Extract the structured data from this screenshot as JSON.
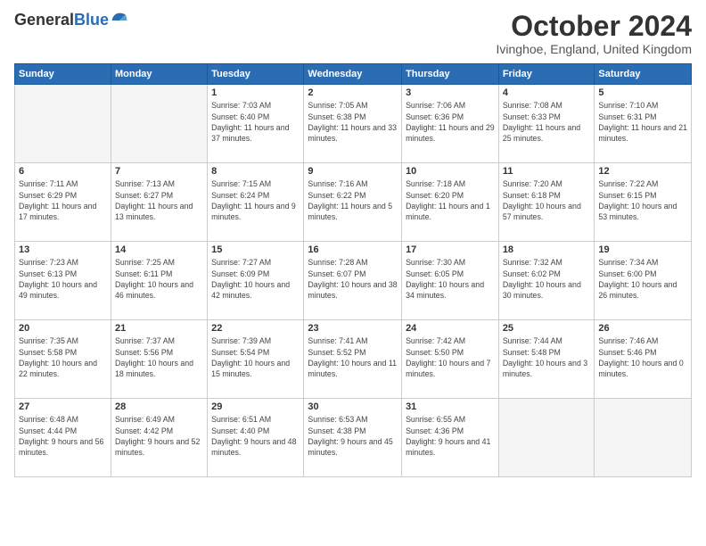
{
  "header": {
    "logo_general": "General",
    "logo_blue": "Blue",
    "month_title": "October 2024",
    "location": "Ivinghoe, England, United Kingdom"
  },
  "days_of_week": [
    "Sunday",
    "Monday",
    "Tuesday",
    "Wednesday",
    "Thursday",
    "Friday",
    "Saturday"
  ],
  "weeks": [
    [
      {
        "day": "",
        "sunrise": "",
        "sunset": "",
        "daylight": ""
      },
      {
        "day": "",
        "sunrise": "",
        "sunset": "",
        "daylight": ""
      },
      {
        "day": "1",
        "sunrise": "Sunrise: 7:03 AM",
        "sunset": "Sunset: 6:40 PM",
        "daylight": "Daylight: 11 hours and 37 minutes."
      },
      {
        "day": "2",
        "sunrise": "Sunrise: 7:05 AM",
        "sunset": "Sunset: 6:38 PM",
        "daylight": "Daylight: 11 hours and 33 minutes."
      },
      {
        "day": "3",
        "sunrise": "Sunrise: 7:06 AM",
        "sunset": "Sunset: 6:36 PM",
        "daylight": "Daylight: 11 hours and 29 minutes."
      },
      {
        "day": "4",
        "sunrise": "Sunrise: 7:08 AM",
        "sunset": "Sunset: 6:33 PM",
        "daylight": "Daylight: 11 hours and 25 minutes."
      },
      {
        "day": "5",
        "sunrise": "Sunrise: 7:10 AM",
        "sunset": "Sunset: 6:31 PM",
        "daylight": "Daylight: 11 hours and 21 minutes."
      }
    ],
    [
      {
        "day": "6",
        "sunrise": "Sunrise: 7:11 AM",
        "sunset": "Sunset: 6:29 PM",
        "daylight": "Daylight: 11 hours and 17 minutes."
      },
      {
        "day": "7",
        "sunrise": "Sunrise: 7:13 AM",
        "sunset": "Sunset: 6:27 PM",
        "daylight": "Daylight: 11 hours and 13 minutes."
      },
      {
        "day": "8",
        "sunrise": "Sunrise: 7:15 AM",
        "sunset": "Sunset: 6:24 PM",
        "daylight": "Daylight: 11 hours and 9 minutes."
      },
      {
        "day": "9",
        "sunrise": "Sunrise: 7:16 AM",
        "sunset": "Sunset: 6:22 PM",
        "daylight": "Daylight: 11 hours and 5 minutes."
      },
      {
        "day": "10",
        "sunrise": "Sunrise: 7:18 AM",
        "sunset": "Sunset: 6:20 PM",
        "daylight": "Daylight: 11 hours and 1 minute."
      },
      {
        "day": "11",
        "sunrise": "Sunrise: 7:20 AM",
        "sunset": "Sunset: 6:18 PM",
        "daylight": "Daylight: 10 hours and 57 minutes."
      },
      {
        "day": "12",
        "sunrise": "Sunrise: 7:22 AM",
        "sunset": "Sunset: 6:15 PM",
        "daylight": "Daylight: 10 hours and 53 minutes."
      }
    ],
    [
      {
        "day": "13",
        "sunrise": "Sunrise: 7:23 AM",
        "sunset": "Sunset: 6:13 PM",
        "daylight": "Daylight: 10 hours and 49 minutes."
      },
      {
        "day": "14",
        "sunrise": "Sunrise: 7:25 AM",
        "sunset": "Sunset: 6:11 PM",
        "daylight": "Daylight: 10 hours and 46 minutes."
      },
      {
        "day": "15",
        "sunrise": "Sunrise: 7:27 AM",
        "sunset": "Sunset: 6:09 PM",
        "daylight": "Daylight: 10 hours and 42 minutes."
      },
      {
        "day": "16",
        "sunrise": "Sunrise: 7:28 AM",
        "sunset": "Sunset: 6:07 PM",
        "daylight": "Daylight: 10 hours and 38 minutes."
      },
      {
        "day": "17",
        "sunrise": "Sunrise: 7:30 AM",
        "sunset": "Sunset: 6:05 PM",
        "daylight": "Daylight: 10 hours and 34 minutes."
      },
      {
        "day": "18",
        "sunrise": "Sunrise: 7:32 AM",
        "sunset": "Sunset: 6:02 PM",
        "daylight": "Daylight: 10 hours and 30 minutes."
      },
      {
        "day": "19",
        "sunrise": "Sunrise: 7:34 AM",
        "sunset": "Sunset: 6:00 PM",
        "daylight": "Daylight: 10 hours and 26 minutes."
      }
    ],
    [
      {
        "day": "20",
        "sunrise": "Sunrise: 7:35 AM",
        "sunset": "Sunset: 5:58 PM",
        "daylight": "Daylight: 10 hours and 22 minutes."
      },
      {
        "day": "21",
        "sunrise": "Sunrise: 7:37 AM",
        "sunset": "Sunset: 5:56 PM",
        "daylight": "Daylight: 10 hours and 18 minutes."
      },
      {
        "day": "22",
        "sunrise": "Sunrise: 7:39 AM",
        "sunset": "Sunset: 5:54 PM",
        "daylight": "Daylight: 10 hours and 15 minutes."
      },
      {
        "day": "23",
        "sunrise": "Sunrise: 7:41 AM",
        "sunset": "Sunset: 5:52 PM",
        "daylight": "Daylight: 10 hours and 11 minutes."
      },
      {
        "day": "24",
        "sunrise": "Sunrise: 7:42 AM",
        "sunset": "Sunset: 5:50 PM",
        "daylight": "Daylight: 10 hours and 7 minutes."
      },
      {
        "day": "25",
        "sunrise": "Sunrise: 7:44 AM",
        "sunset": "Sunset: 5:48 PM",
        "daylight": "Daylight: 10 hours and 3 minutes."
      },
      {
        "day": "26",
        "sunrise": "Sunrise: 7:46 AM",
        "sunset": "Sunset: 5:46 PM",
        "daylight": "Daylight: 10 hours and 0 minutes."
      }
    ],
    [
      {
        "day": "27",
        "sunrise": "Sunrise: 6:48 AM",
        "sunset": "Sunset: 4:44 PM",
        "daylight": "Daylight: 9 hours and 56 minutes."
      },
      {
        "day": "28",
        "sunrise": "Sunrise: 6:49 AM",
        "sunset": "Sunset: 4:42 PM",
        "daylight": "Daylight: 9 hours and 52 minutes."
      },
      {
        "day": "29",
        "sunrise": "Sunrise: 6:51 AM",
        "sunset": "Sunset: 4:40 PM",
        "daylight": "Daylight: 9 hours and 48 minutes."
      },
      {
        "day": "30",
        "sunrise": "Sunrise: 6:53 AM",
        "sunset": "Sunset: 4:38 PM",
        "daylight": "Daylight: 9 hours and 45 minutes."
      },
      {
        "day": "31",
        "sunrise": "Sunrise: 6:55 AM",
        "sunset": "Sunset: 4:36 PM",
        "daylight": "Daylight: 9 hours and 41 minutes."
      },
      {
        "day": "",
        "sunrise": "",
        "sunset": "",
        "daylight": ""
      },
      {
        "day": "",
        "sunrise": "",
        "sunset": "",
        "daylight": ""
      }
    ]
  ]
}
